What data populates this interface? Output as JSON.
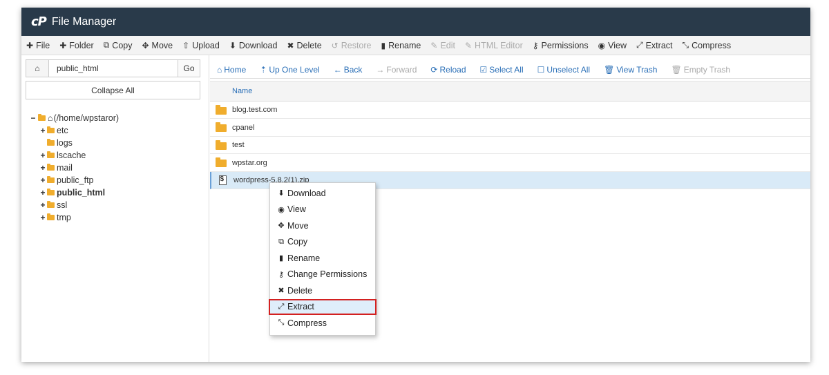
{
  "app": {
    "logo": "cP",
    "title": "File Manager"
  },
  "toolbar": [
    {
      "icon": "plus",
      "label": "File",
      "disabled": false
    },
    {
      "icon": "plus",
      "label": "Folder",
      "disabled": false
    },
    {
      "icon": "copy",
      "label": "Copy",
      "disabled": false
    },
    {
      "icon": "move",
      "label": "Move",
      "disabled": false
    },
    {
      "icon": "upload",
      "label": "Upload",
      "disabled": false
    },
    {
      "icon": "download",
      "label": "Download",
      "disabled": false
    },
    {
      "icon": "close",
      "label": "Delete",
      "disabled": false
    },
    {
      "icon": "restore",
      "label": "Restore",
      "disabled": true
    },
    {
      "icon": "file",
      "label": "Rename",
      "disabled": false
    },
    {
      "icon": "pencil",
      "label": "Edit",
      "disabled": true
    },
    {
      "icon": "edit-box",
      "label": "HTML Editor",
      "disabled": true
    },
    {
      "icon": "key",
      "label": "Permissions",
      "disabled": false
    },
    {
      "icon": "eye",
      "label": "View",
      "disabled": false
    },
    {
      "icon": "expand",
      "label": "Extract",
      "disabled": false
    },
    {
      "icon": "compress",
      "label": "Compress",
      "disabled": false
    }
  ],
  "path": {
    "home_icon": "home",
    "value": "public_html",
    "go_label": "Go"
  },
  "collapse_label": "Collapse All",
  "tree": {
    "root": "(/home/wpstaror)",
    "items": [
      {
        "label": "etc",
        "expandable": true,
        "bold": false
      },
      {
        "label": "logs",
        "expandable": false,
        "bold": false
      },
      {
        "label": "lscache",
        "expandable": true,
        "bold": false
      },
      {
        "label": "mail",
        "expandable": true,
        "bold": false
      },
      {
        "label": "public_ftp",
        "expandable": true,
        "bold": false
      },
      {
        "label": "public_html",
        "expandable": true,
        "bold": true
      },
      {
        "label": "ssl",
        "expandable": true,
        "bold": false
      },
      {
        "label": "tmp",
        "expandable": true,
        "bold": false
      }
    ]
  },
  "subbar": [
    {
      "icon": "home",
      "label": "Home",
      "disabled": false
    },
    {
      "icon": "level-up",
      "label": "Up One Level",
      "disabled": false
    },
    {
      "icon": "arrow-left",
      "label": "Back",
      "disabled": false
    },
    {
      "icon": "arrow-right",
      "label": "Forward",
      "disabled": true
    },
    {
      "icon": "refresh",
      "label": "Reload",
      "disabled": false
    },
    {
      "icon": "check-square",
      "label": "Select All",
      "disabled": false
    },
    {
      "icon": "square",
      "label": "Unselect All",
      "disabled": false
    },
    {
      "icon": "trash",
      "label": "View Trash",
      "disabled": false
    },
    {
      "icon": "trash",
      "label": "Empty Trash",
      "disabled": true
    }
  ],
  "list": {
    "header": "Name",
    "rows": [
      {
        "name": "blog.test.com",
        "type": "folder"
      },
      {
        "name": "cpanel",
        "type": "folder"
      },
      {
        "name": "test",
        "type": "folder"
      },
      {
        "name": "wpstar.org",
        "type": "folder"
      },
      {
        "name": "wordpress-5.8.2(1).zip",
        "type": "zip"
      }
    ]
  },
  "context_menu": [
    {
      "icon": "download",
      "label": "Download"
    },
    {
      "icon": "eye",
      "label": "View"
    },
    {
      "icon": "move",
      "label": "Move"
    },
    {
      "icon": "copy",
      "label": "Copy"
    },
    {
      "icon": "file",
      "label": "Rename"
    },
    {
      "icon": "key",
      "label": "Change Permissions"
    },
    {
      "icon": "close",
      "label": "Delete"
    },
    {
      "icon": "expand",
      "label": "Extract",
      "highlighted": true
    },
    {
      "icon": "compress",
      "label": "Compress"
    }
  ],
  "colors": {
    "titlebar": "#293a4a",
    "link": "#2a6fb7",
    "folder": "#f0ad2d",
    "highlight_border": "#d32020"
  }
}
